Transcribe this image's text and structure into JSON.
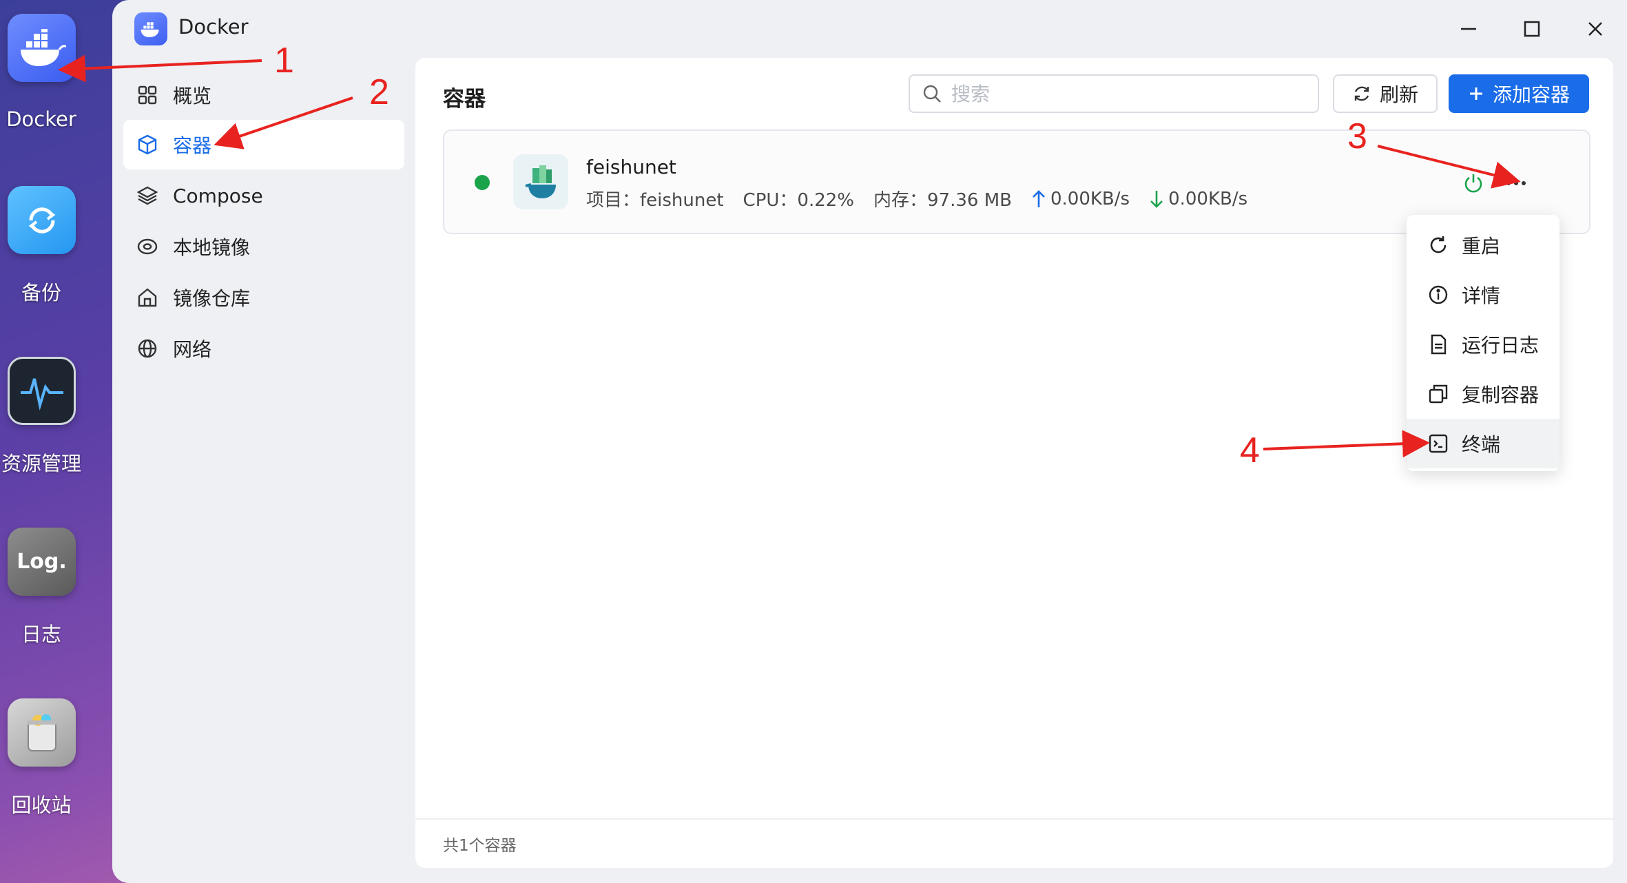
{
  "dock": {
    "apps": [
      {
        "label": "Docker",
        "icon": "docker-icon"
      },
      {
        "label": "备份",
        "icon": "backup-icon"
      },
      {
        "label": "资源管理",
        "icon": "activity-monitor-icon"
      },
      {
        "label": "日志",
        "icon": "log-icon"
      },
      {
        "label": "回收站",
        "icon": "trash-icon"
      }
    ],
    "log_icon_text": "Log."
  },
  "window": {
    "title": "Docker",
    "controls": [
      "minimize",
      "maximize",
      "close"
    ]
  },
  "sidebar": {
    "items": [
      {
        "label": "概览",
        "icon": "grid-icon"
      },
      {
        "label": "容器",
        "icon": "cube-icon",
        "active": true
      },
      {
        "label": "Compose",
        "icon": "layers-icon"
      },
      {
        "label": "本地镜像",
        "icon": "disc-icon"
      },
      {
        "label": "镜像仓库",
        "icon": "home-icon"
      },
      {
        "label": "网络",
        "icon": "globe-icon"
      }
    ]
  },
  "main": {
    "title": "容器",
    "search_placeholder": "搜索",
    "refresh_label": "刷新",
    "add_label": "添加容器",
    "footer": "共1个容器"
  },
  "container": {
    "name": "feishunet",
    "status": "running",
    "project": "项目：feishunet",
    "cpu": "CPU：0.22%",
    "memory": "内存：97.36 MB",
    "upload": "0.00KB/s",
    "download": "0.00KB/s"
  },
  "menu": {
    "items": [
      {
        "label": "重启",
        "icon": "restart-icon"
      },
      {
        "label": "详情",
        "icon": "info-icon"
      },
      {
        "label": "运行日志",
        "icon": "file-log-icon"
      },
      {
        "label": "复制容器",
        "icon": "copy-icon"
      },
      {
        "label": "终端",
        "icon": "terminal-icon"
      }
    ]
  },
  "annotations": [
    "1",
    "2",
    "3",
    "4"
  ],
  "colors": {
    "accent": "#1a6ce8",
    "running": "#1aa34a",
    "annotation": "#e8231f"
  }
}
